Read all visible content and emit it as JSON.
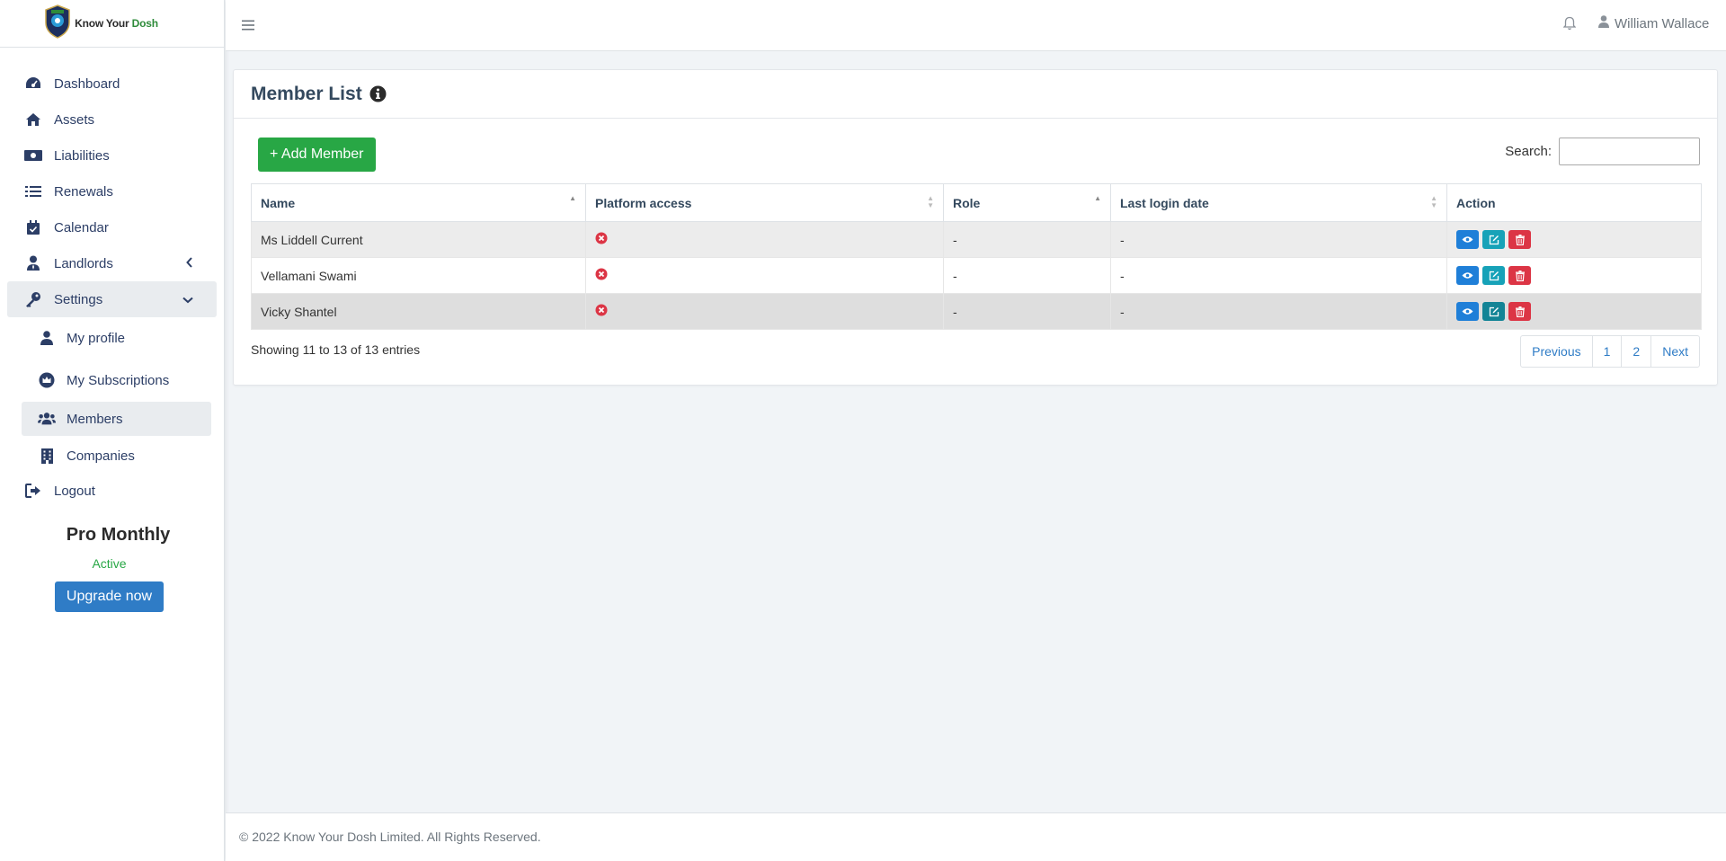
{
  "brand": {
    "name_part1": "Know Your ",
    "name_part2": "Dosh"
  },
  "sidebar": {
    "items": [
      {
        "label": "Dashboard",
        "icon": "gauge-icon"
      },
      {
        "label": "Assets",
        "icon": "home-icon"
      },
      {
        "label": "Liabilities",
        "icon": "money-bill-icon"
      },
      {
        "label": "Renewals",
        "icon": "list-icon"
      },
      {
        "label": "Calendar",
        "icon": "calendar-check-icon"
      },
      {
        "label": "Landlords",
        "icon": "user-tie-icon"
      },
      {
        "label": "Settings",
        "icon": "key-icon"
      }
    ],
    "sub_items": [
      {
        "label": "My profile",
        "icon": "user-icon"
      },
      {
        "label": "My Subscriptions",
        "icon": "crown-icon"
      },
      {
        "label": "Members",
        "icon": "users-icon"
      },
      {
        "label": "Companies",
        "icon": "building-icon"
      }
    ],
    "logout": "Logout",
    "plan_name": "Pro Monthly",
    "plan_status": "Active",
    "upgrade_label": "Upgrade now"
  },
  "topbar": {
    "user_name": "William Wallace"
  },
  "main": {
    "title": "Member List",
    "add_label": "+ Add Member",
    "search_label": "Search:",
    "search_value": "",
    "columns": [
      "Name",
      "Platform access",
      "Role",
      "Last login date",
      "Action"
    ],
    "rows": [
      {
        "name": "Ms Liddell Current",
        "role": "-",
        "last_login": "-"
      },
      {
        "name": "Vellamani Swami",
        "role": "-",
        "last_login": "-"
      },
      {
        "name": "Vicky Shantel",
        "role": "-",
        "last_login": "-"
      }
    ],
    "showing": "Showing 11 to 13 of 13 entries",
    "pagination": {
      "previous": "Previous",
      "page1": "1",
      "page2": "2",
      "next": "Next"
    }
  },
  "footer": {
    "text": "© 2022 Know Your Dosh Limited. All Rights Reserved."
  },
  "colors": {
    "primary": "#2f7cc6",
    "success": "#28a745",
    "danger": "#dc3545",
    "info": "#17a2b8",
    "nav_text": "#2c3e66"
  }
}
